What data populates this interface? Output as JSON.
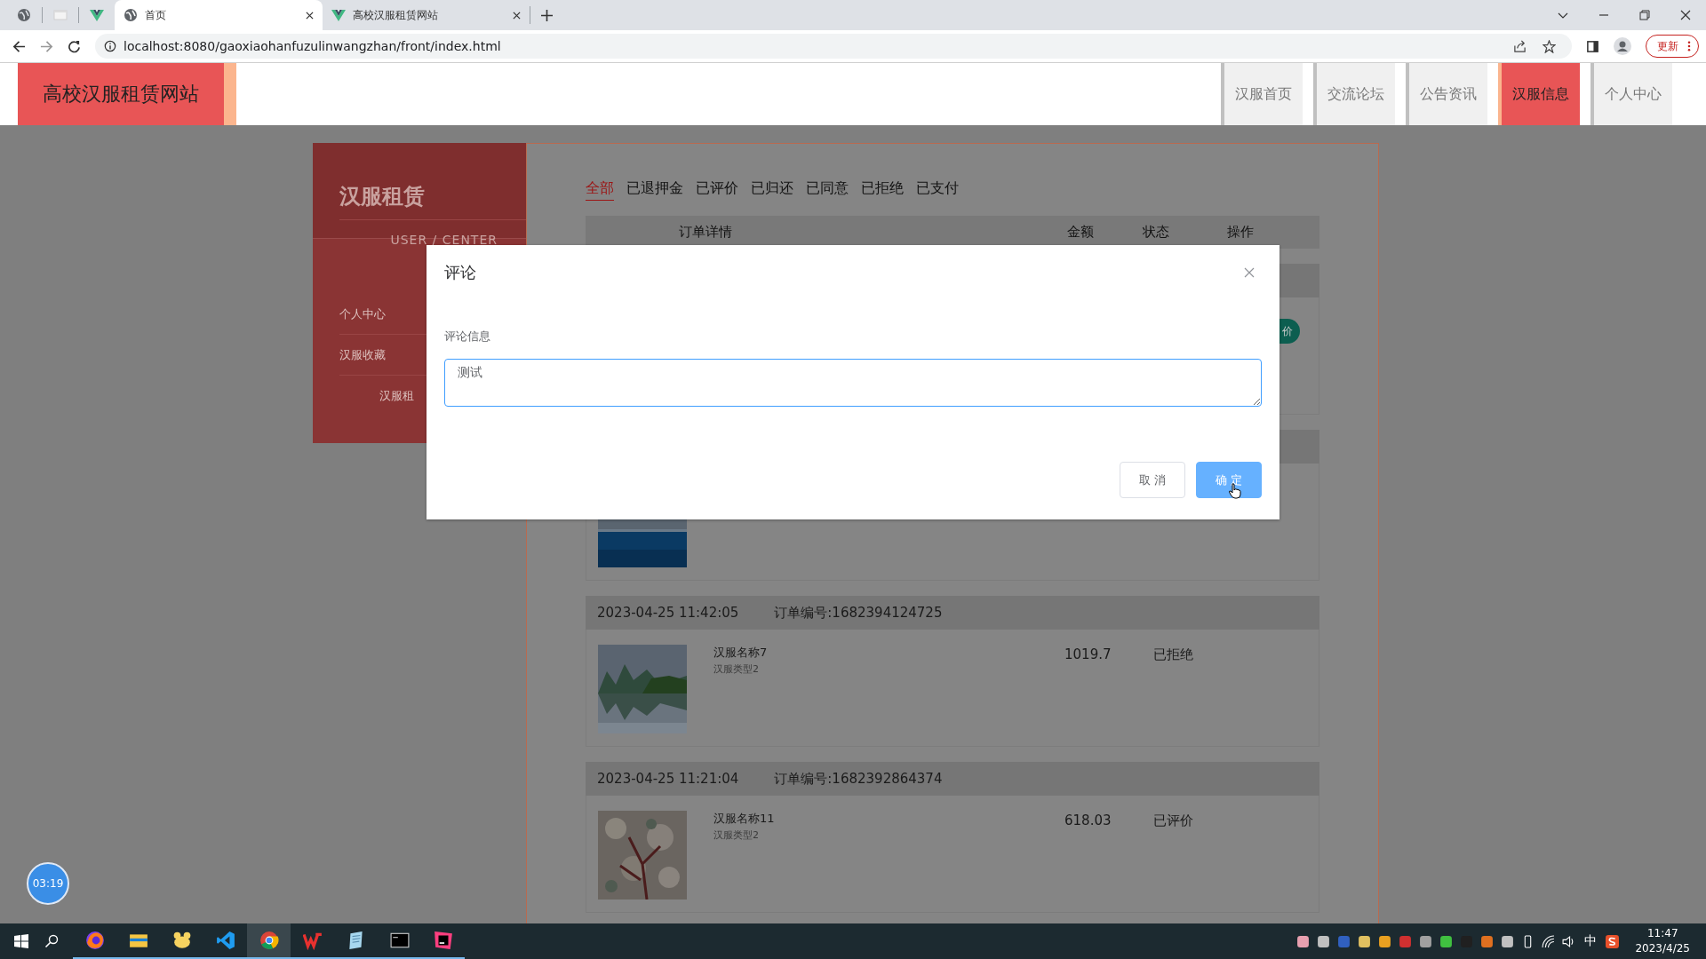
{
  "browser": {
    "tabs": [
      {
        "title": "首页",
        "selected": true
      },
      {
        "title": "高校汉服租赁网站",
        "selected": false
      }
    ],
    "url": "localhost:8080/gaoxiaohanfuzulinwangzhan/front/index.html",
    "update_button": "更新"
  },
  "site": {
    "title": "高校汉服租赁网站",
    "nav": [
      {
        "label": "汉服首页",
        "selected": false
      },
      {
        "label": "交流论坛",
        "selected": false
      },
      {
        "label": "公告资讯",
        "selected": false
      },
      {
        "label": "汉服信息",
        "selected": true
      },
      {
        "label": "个人中心",
        "selected": false
      }
    ]
  },
  "sidebar": {
    "title": "汉服租赁",
    "subtitle": "USER / CENTER",
    "items": [
      "个人中心",
      "汉服收藏",
      "汉服租"
    ]
  },
  "filters": [
    {
      "label": "全部",
      "selected": true
    },
    {
      "label": "已退押金",
      "selected": false
    },
    {
      "label": "已评价",
      "selected": false
    },
    {
      "label": "已归还",
      "selected": false
    },
    {
      "label": "已同意",
      "selected": false
    },
    {
      "label": "已拒绝",
      "selected": false
    },
    {
      "label": "已支付",
      "selected": false
    }
  ],
  "table_columns": [
    "订单详情",
    "金额",
    "状态",
    "操作"
  ],
  "orders": [
    {
      "action": "价"
    },
    {
      "image": {
        "kind": "picture"
      }
    },
    {
      "time": "2023-04-25 11:42:05",
      "order_no": "订单编号:1682394124725",
      "image": {
        "kind": "picture"
      },
      "name": "汉服名称7",
      "type": "汉服类型2",
      "amount": "1019.7",
      "status": "已拒绝"
    },
    {
      "time": "2023-04-25 11:21:04",
      "order_no": "订单编号:1682392864374",
      "image": {
        "kind": "picture"
      },
      "name": "汉服名称11",
      "type": "汉服类型2",
      "amount": "618.03",
      "status": "已评价"
    }
  ],
  "dialog": {
    "title": "评论",
    "field_label": "评论信息",
    "value": "测试",
    "cancel": "取 消",
    "confirm": "确 定"
  },
  "recorder": "03:19",
  "taskbar": {
    "ime": "中",
    "time": "11:47",
    "date": "2023/4/25"
  }
}
